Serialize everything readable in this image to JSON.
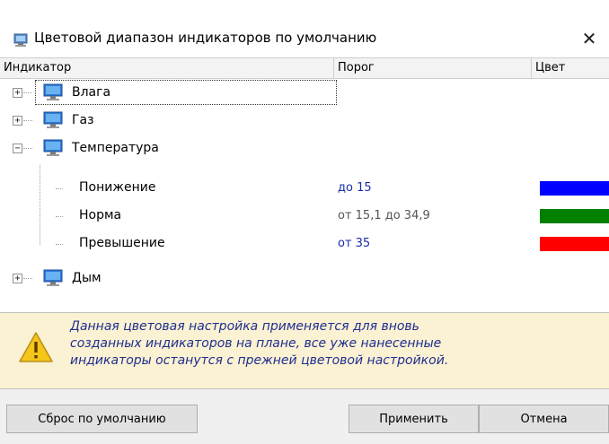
{
  "window": {
    "title": "Цветовой диапазон индикаторов по умолчанию",
    "title_icon": "computer-icon",
    "close_icon": "close-icon"
  },
  "columns": [
    "Индикатор",
    "Порог",
    "Цвет"
  ],
  "tree": {
    "nodes": [
      {
        "label": "Влага",
        "expander": "+",
        "icon": "monitor-icon"
      },
      {
        "label": "Газ",
        "expander": "+",
        "icon": "monitor-icon"
      },
      {
        "label": "Температура",
        "expander": "−",
        "icon": "monitor-icon",
        "children": [
          {
            "label": "Понижение",
            "threshold": "до 15",
            "threshold_color": "#1a2ea8",
            "color": "#0000ff"
          },
          {
            "label": "Норма",
            "threshold": "от 15,1 до 34,9",
            "threshold_color": "#555555",
            "color": "#008000"
          },
          {
            "label": "Превышение",
            "threshold": "от 35",
            "threshold_color": "#1a2ea8",
            "color": "#ff0000"
          }
        ]
      },
      {
        "label": "Дым",
        "expander": "+",
        "icon": "monitor-icon"
      }
    ]
  },
  "notice": {
    "icon": "warning-icon",
    "lines": [
      "Данная цветовая настройка применяется для вновь",
      "созданных индикаторов на плане, все уже нанесенные",
      "индикаторы останутся с прежней цветовой настройкой."
    ]
  },
  "buttons": {
    "reset": "Сброс по умолчанию",
    "apply": "Применить",
    "cancel": "Отмена"
  }
}
